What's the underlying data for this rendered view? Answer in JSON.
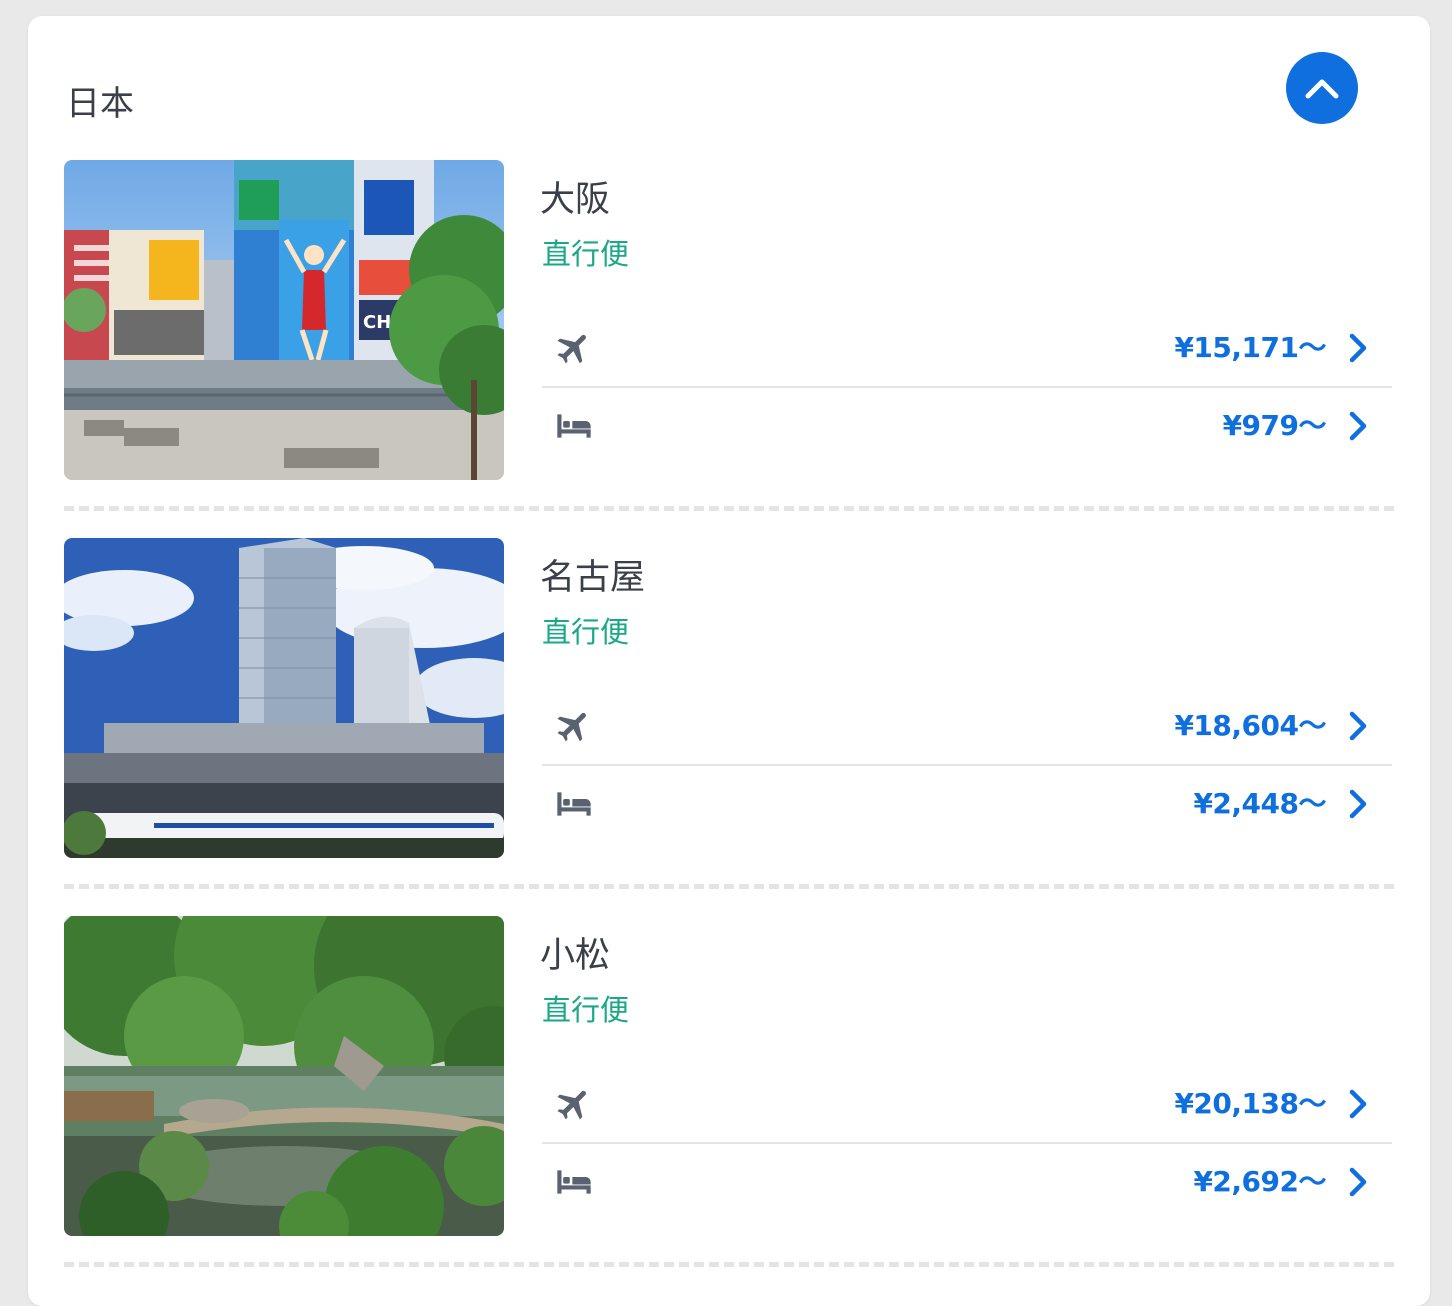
{
  "region": {
    "title": "日本"
  },
  "colors": {
    "accent": "#0f6fde",
    "direct": "#1aa886",
    "text": "#3b3f4a",
    "icon": "#5a6170"
  },
  "destinations": [
    {
      "name": "大阪",
      "tag": "直行便",
      "flight_price": "¥15,171～",
      "hotel_price": "¥979～",
      "photo": "osaka-dotonbori-photo"
    },
    {
      "name": "名古屋",
      "tag": "直行便",
      "flight_price": "¥18,604～",
      "hotel_price": "¥2,448～",
      "photo": "nagoya-towers-photo"
    },
    {
      "name": "小松",
      "tag": "直行便",
      "flight_price": "¥20,138～",
      "hotel_price": "¥2,692～",
      "photo": "kenrokuen-garden-photo"
    }
  ],
  "icons": {
    "collapse": "chevron-up-icon",
    "flight": "airplane-icon",
    "hotel": "bed-icon",
    "go": "chevron-right-icon"
  }
}
